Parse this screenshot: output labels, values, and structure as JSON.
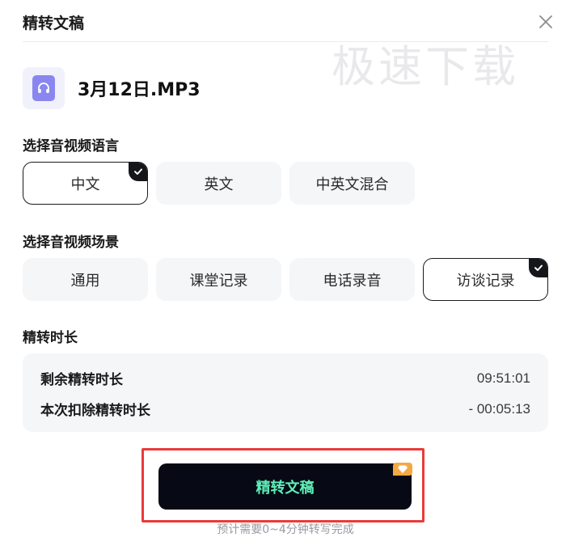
{
  "dialog": {
    "title": "精转文稿",
    "watermark": "极速下载"
  },
  "file": {
    "name": "3月12日.MP3",
    "icon": "headphones-icon"
  },
  "language_section": {
    "label": "选择音视频语言",
    "options": [
      "中文",
      "英文",
      "中英文混合"
    ],
    "selected": "中文"
  },
  "scene_section": {
    "label": "选择音视频场景",
    "options": [
      "通用",
      "课堂记录",
      "电话录音",
      "访谈记录"
    ],
    "selected": "访谈记录"
  },
  "duration_section": {
    "label": "精转时长",
    "remaining_label": "剩余精转时长",
    "remaining_value": "09:51:01",
    "deduct_label": "本次扣除精转时长",
    "deduct_value": "- 00:05:13"
  },
  "submit": {
    "label": "精转文稿",
    "hint": "预计需要0~4分钟转写完成"
  },
  "colors": {
    "button_bg": "#070a14",
    "button_text": "#5ef0b9",
    "highlight": "#ea3a3a",
    "vip": "#f5a942"
  }
}
